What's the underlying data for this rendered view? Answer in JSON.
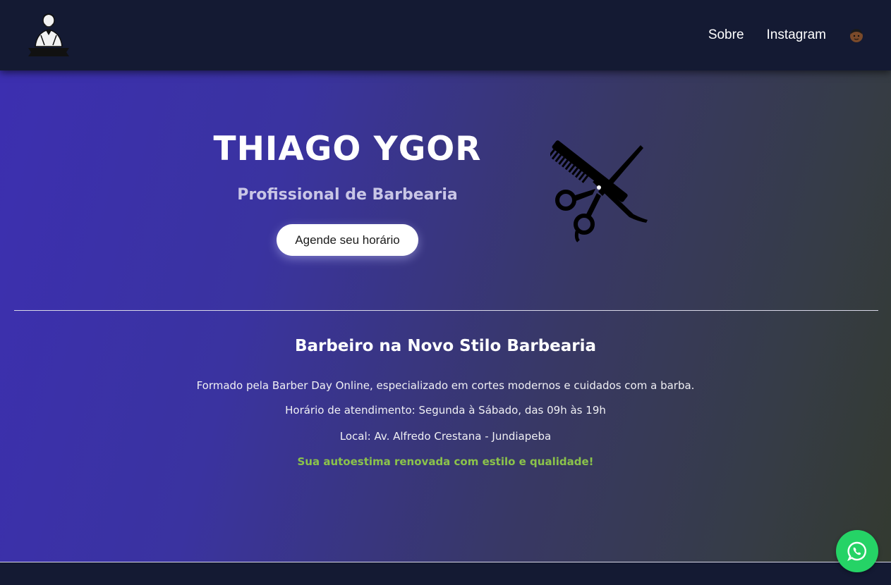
{
  "header": {
    "logo_icon": "barber-logo-icon",
    "nav": [
      {
        "label": "Sobre"
      },
      {
        "label": "Instagram"
      }
    ],
    "avatar_icon": "face-emoji-icon"
  },
  "hero": {
    "title": "THIAGO YGOR",
    "subtitle": "Profissional de Barbearia",
    "cta_label": "Agende seu horário",
    "image_icon": "scissors-comb-icon"
  },
  "about": {
    "title": "Barbeiro na Novo Stilo Barbearia",
    "line1": "Formado pela Barber Day Online, especializado em cortes modernos e cuidados com a barba.",
    "line2": "Horário de atendimento: Segunda à Sábado, das 09h às 19h",
    "line3": "Local: Av. Alfredo Crestana - Jundiapeba",
    "tagline": "Sua autoestima renovada com estilo e qualidade!"
  },
  "floating": {
    "whatsapp_icon": "whatsapp-icon"
  },
  "colors": {
    "header_bg": "#141a33",
    "gradient_start": "#3c2fb0",
    "gradient_end": "#333a30",
    "tagline": "#8bc34a",
    "whatsapp": "#25d366"
  }
}
